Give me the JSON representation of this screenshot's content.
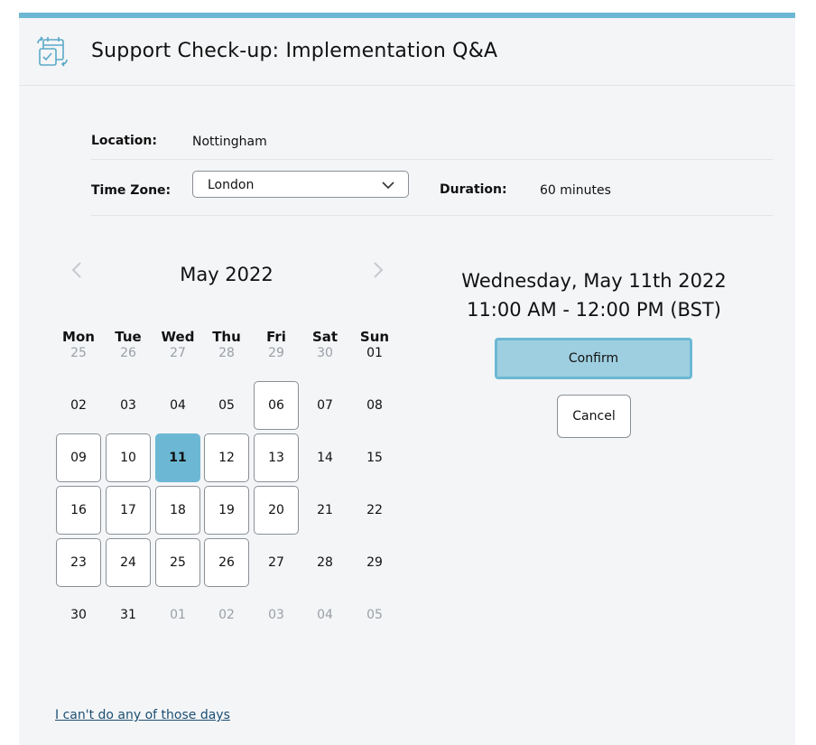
{
  "header": {
    "title": "Support Check-up: Implementation Q&A",
    "icon": "calendar-sync-icon"
  },
  "info": {
    "location_label": "Location:",
    "location_value": "Nottingham",
    "timezone_label": "Time Zone:",
    "timezone_value": "London",
    "duration_label": "Duration:",
    "duration_value": "60 minutes"
  },
  "calendar": {
    "month_title": "May 2022",
    "weekdays": [
      "Mon",
      "Tue",
      "Wed",
      "Thu",
      "Fri",
      "Sat",
      "Sun"
    ],
    "weeks": [
      [
        {
          "label": "25",
          "state": "dim"
        },
        {
          "label": "26",
          "state": "dim"
        },
        {
          "label": "27",
          "state": "dim"
        },
        {
          "label": "28",
          "state": "dim"
        },
        {
          "label": "29",
          "state": "dim"
        },
        {
          "label": "30",
          "state": "dim"
        },
        {
          "label": "01",
          "state": "plain"
        }
      ],
      [
        {
          "label": "02",
          "state": "plain"
        },
        {
          "label": "03",
          "state": "plain"
        },
        {
          "label": "04",
          "state": "plain"
        },
        {
          "label": "05",
          "state": "plain"
        },
        {
          "label": "06",
          "state": "available"
        },
        {
          "label": "07",
          "state": "plain"
        },
        {
          "label": "08",
          "state": "plain"
        }
      ],
      [
        {
          "label": "09",
          "state": "available"
        },
        {
          "label": "10",
          "state": "available"
        },
        {
          "label": "11",
          "state": "selected"
        },
        {
          "label": "12",
          "state": "available"
        },
        {
          "label": "13",
          "state": "available"
        },
        {
          "label": "14",
          "state": "plain"
        },
        {
          "label": "15",
          "state": "plain"
        }
      ],
      [
        {
          "label": "16",
          "state": "available"
        },
        {
          "label": "17",
          "state": "available"
        },
        {
          "label": "18",
          "state": "available"
        },
        {
          "label": "19",
          "state": "available"
        },
        {
          "label": "20",
          "state": "available"
        },
        {
          "label": "21",
          "state": "plain"
        },
        {
          "label": "22",
          "state": "plain"
        }
      ],
      [
        {
          "label": "23",
          "state": "available"
        },
        {
          "label": "24",
          "state": "available"
        },
        {
          "label": "25",
          "state": "available"
        },
        {
          "label": "26",
          "state": "available"
        },
        {
          "label": "27",
          "state": "plain"
        },
        {
          "label": "28",
          "state": "plain"
        },
        {
          "label": "29",
          "state": "plain"
        }
      ],
      [
        {
          "label": "30",
          "state": "plain"
        },
        {
          "label": "31",
          "state": "plain"
        },
        {
          "label": "01",
          "state": "dim"
        },
        {
          "label": "02",
          "state": "dim"
        },
        {
          "label": "03",
          "state": "dim"
        },
        {
          "label": "04",
          "state": "dim"
        },
        {
          "label": "05",
          "state": "dim"
        }
      ]
    ]
  },
  "selection": {
    "date_line": "Wednesday, May 11th 2022",
    "time_line": "11:00 AM - 12:00 PM (BST)",
    "confirm_label": "Confirm",
    "cancel_label": "Cancel"
  },
  "footer": {
    "no_days_link": "I can't do any of those days"
  },
  "colors": {
    "accent": "#6cb8d4",
    "confirm_fill": "#9ecfe0",
    "panel_bg": "#f4f5f7",
    "link": "#1c4f72"
  }
}
